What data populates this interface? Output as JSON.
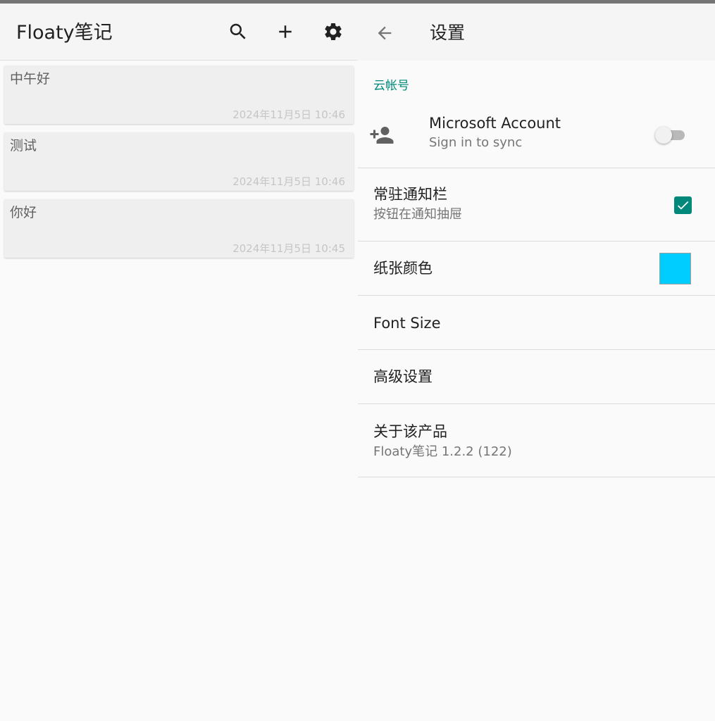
{
  "notes_pane": {
    "title": "Floaty笔记",
    "actions": [
      "search-icon",
      "add-icon",
      "settings-icon"
    ],
    "notes": [
      {
        "text": "中午好",
        "date": "2024年11月5日 10:46"
      },
      {
        "text": "测试",
        "date": "2024年11月5日 10:46"
      },
      {
        "text": "你好",
        "date": "2024年11月5日 10:45"
      }
    ]
  },
  "settings_pane": {
    "title": "设置",
    "back_icon": "arrow-back-icon",
    "category": "云帐号",
    "account": {
      "title": "Microsoft Account",
      "summary": "Sign in to sync",
      "icon": "person-add-icon",
      "enabled": false
    },
    "notification": {
      "title": "常驻通知栏",
      "summary": "按钮在通知抽屉",
      "checked": true
    },
    "paper_color": {
      "title": "纸张颜色",
      "color": "#00cdff"
    },
    "font_size": {
      "title": "Font Size"
    },
    "advanced": {
      "title": "高级设置"
    },
    "about": {
      "title": "关于该产品",
      "summary": "Floaty笔记 1.2.2 (122)"
    }
  },
  "colors": {
    "accent": "#00897b",
    "background": "#fafafa",
    "appbar": "#f5f5f5",
    "note_card": "#efefef"
  }
}
